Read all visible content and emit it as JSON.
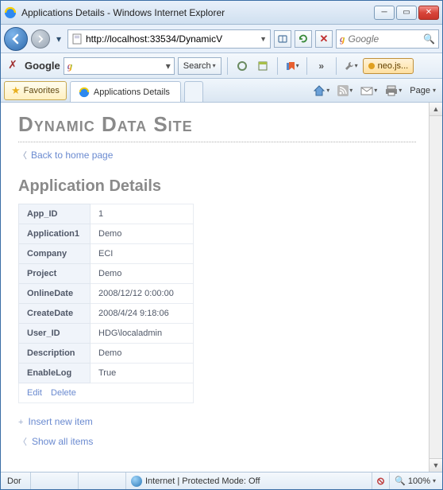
{
  "window": {
    "title": "Applications Details - Windows Internet Explorer"
  },
  "nav": {
    "url": "http://localhost:33534/DynamicV"
  },
  "search_top": {
    "placeholder": "Google"
  },
  "google_toolbar": {
    "label": "Google",
    "search_btn": "Search",
    "neo": "neo.js..."
  },
  "favorites": {
    "label": "Favorites"
  },
  "tab": {
    "label": "Applications Details"
  },
  "page_menu": {
    "label": "Page"
  },
  "site": {
    "title": "Dynamic Data Site",
    "back_link": "Back to home page",
    "section_title": "Application Details",
    "edit": "Edit",
    "delete": "Delete",
    "insert": "Insert new item",
    "showall": "Show all items"
  },
  "details": [
    {
      "label": "App_ID",
      "value": "1"
    },
    {
      "label": "Application1",
      "value": "Demo"
    },
    {
      "label": "Company",
      "value": "ECI"
    },
    {
      "label": "Project",
      "value": "Demo"
    },
    {
      "label": "OnlineDate",
      "value": "2008/12/12 0:00:00"
    },
    {
      "label": "CreateDate",
      "value": "2008/4/24 9:18:06"
    },
    {
      "label": "User_ID",
      "value": "HDG\\localadmin"
    },
    {
      "label": "Description",
      "value": "Demo"
    },
    {
      "label": "EnableLog",
      "value": "True"
    }
  ],
  "status": {
    "left": "Dor",
    "zone": "Internet | Protected Mode: Off",
    "zoom": "100%"
  }
}
